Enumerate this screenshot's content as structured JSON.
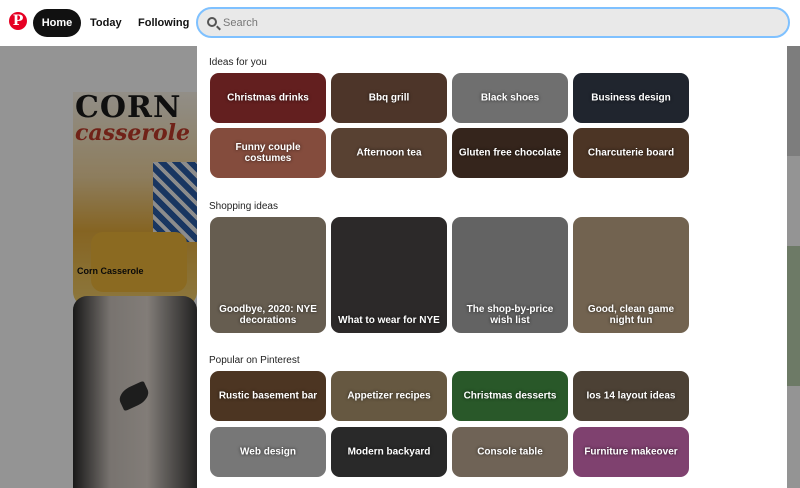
{
  "header": {
    "logo_glyph": "P",
    "nav": {
      "home": "Home",
      "today": "Today",
      "following": "Following"
    },
    "search_placeholder": "Search"
  },
  "feed": {
    "pin1": {
      "title_top": "CORN",
      "title_script": "casserole",
      "label": "Corn Casserole"
    }
  },
  "panel": {
    "sections": [
      {
        "title": "Ideas for you",
        "tiles": [
          {
            "label": "Christmas drinks",
            "color": "#8a2c2c"
          },
          {
            "label": "Bbq grill",
            "color": "#6b4a3a"
          },
          {
            "label": "Black shoes",
            "color": "#9a9a9a"
          },
          {
            "label": "Business design",
            "color": "#2d3440"
          },
          {
            "label": "Funny couple costumes",
            "color": "#b76a55"
          },
          {
            "label": "Afternoon tea",
            "color": "#7a5a46"
          },
          {
            "label": "Gluten free chocolate",
            "color": "#4a3428"
          },
          {
            "label": "Charcuterie board",
            "color": "#6a4a34"
          }
        ]
      },
      {
        "title": "Shopping ideas",
        "tiles": [
          {
            "label": "Goodbye, 2020: NYE decorations",
            "color": "#8e8170"
          },
          {
            "label": "What to wear for NYE",
            "color": "#3e3a3a"
          },
          {
            "label": "The shop-by-price wish list",
            "color": "#8a8a8a"
          },
          {
            "label": "Good, clean game night fun",
            "color": "#9e8a70"
          }
        ]
      },
      {
        "title": "Popular on Pinterest",
        "tiles": [
          {
            "label": "Rustic basement bar",
            "color": "#6a4a30"
          },
          {
            "label": "Appetizer recipes",
            "color": "#8e7a5a"
          },
          {
            "label": "Christmas desserts",
            "color": "#3a7a3a"
          },
          {
            "label": "Ios 14 layout ideas",
            "color": "#6a5a4a"
          },
          {
            "label": "Web design",
            "color": "#a6a6a6"
          },
          {
            "label": "Modern backyard",
            "color": "#3a3a3a"
          },
          {
            "label": "Console table",
            "color": "#9a8a78"
          },
          {
            "label": "Furniture makeover",
            "color": "#b05a9a"
          }
        ]
      }
    ]
  }
}
